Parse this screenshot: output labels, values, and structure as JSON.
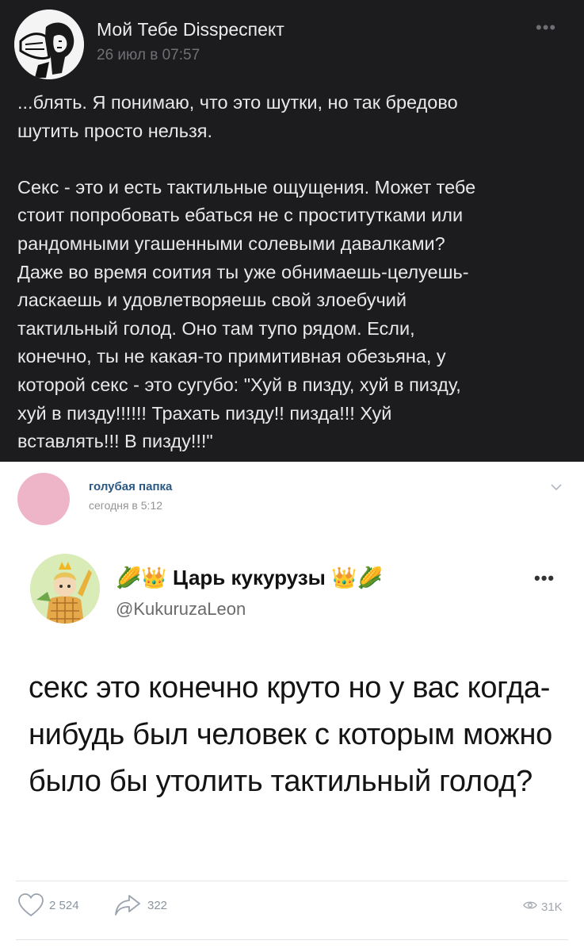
{
  "dark_post": {
    "author": "Мой Тебе Dissреспект",
    "date": "26 июл в 07:57",
    "menu": "•••",
    "paragraphs": [
      "...блять. Я понимаю, что это шутки, но так бредово\nшутить просто нельзя.",
      "Секс - это и есть тактильные ощущения. Может тебе\nстоит попробовать ебаться не с проститутками или\nрандомными угашенными солевыми давалками?\nДаже во время соития ты уже обнимаешь-целуешь-\nласкаешь и удовлетворяешь свой злоебучий\nтактильный голод. Оно там тупо рядом. Если,\nконечно, ты не какая-то примитивная обезьяна, у\nкоторой секс - это сугубо: \"Хуй в пизду, хуй в пизду,\nхуй в пизду!!!!!! Трахать пизду!! пизда!!! Хуй\nвставлять!!! В пизду!!!\""
    ]
  },
  "repost": {
    "author": "голубая папка",
    "date": "сегодня в 5:12",
    "chevron": "⌄"
  },
  "tweet": {
    "display_name": "Царь кукурузы",
    "emoji_left": "🌽👑",
    "emoji_right": "👑🌽",
    "handle": "@KukuruzaLeon",
    "menu": "•••",
    "text": "секс это конечно круто но у вас когда-нибудь был человек с которым можно было бы утолить тактильный голод?"
  },
  "footer": {
    "likes": "2 524",
    "shares": "322",
    "views": "31K"
  },
  "colors": {
    "dark_bg": "#1c1c1e",
    "link_blue": "#2a5885",
    "avatar_pink": "#eeb5c8"
  }
}
